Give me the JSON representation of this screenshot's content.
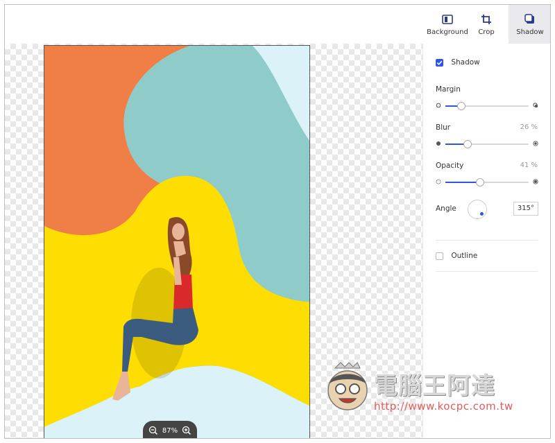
{
  "toolbar": {
    "tools": [
      {
        "label": "Background",
        "icon": "background-icon"
      },
      {
        "label": "Crop",
        "icon": "crop-icon"
      },
      {
        "label": "Shadow",
        "icon": "shadow-icon",
        "active": true
      }
    ]
  },
  "canvas": {
    "zoom": "87%"
  },
  "panel": {
    "shadow_label": "Shadow",
    "shadow_checked": true,
    "margin_label": "Margin",
    "margin_value": 18,
    "blur_label": "Blur",
    "blur_value": "26 %",
    "blur_fraction": 0.26,
    "opacity_label": "Opacity",
    "opacity_value": "41 %",
    "opacity_fraction": 0.41,
    "angle_label": "Angle",
    "angle_value": "315°",
    "outline_label": "Outline",
    "outline_checked": false
  },
  "watermark": {
    "title": "電腦王阿達",
    "url": "http://www.kocpc.com.tw"
  },
  "colors": {
    "accent": "#2f54eb",
    "orange": "#ef7f47",
    "teal": "#8ecbc9",
    "yellow": "#fedd03",
    "pale_blue": "#dbf3f8"
  }
}
